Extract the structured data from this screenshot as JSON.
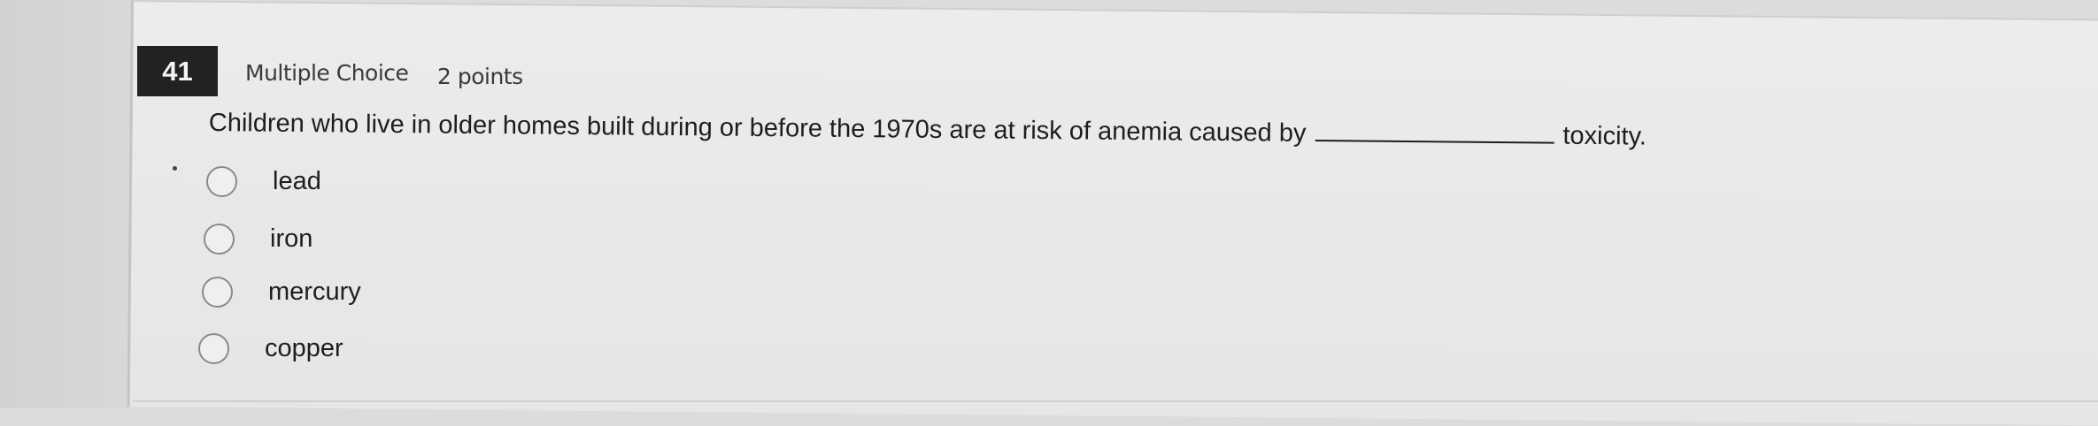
{
  "question": {
    "number": "41",
    "type": "Multiple Choice",
    "points": "2 points",
    "text_before": "Children who live in older homes built during or before the 1970s are at risk of anemia caused by",
    "text_after": "toxicity."
  },
  "options": [
    {
      "label": "lead",
      "selected": false
    },
    {
      "label": "iron",
      "selected": false
    },
    {
      "label": "mercury",
      "selected": false
    },
    {
      "label": "copper",
      "selected": false
    }
  ]
}
